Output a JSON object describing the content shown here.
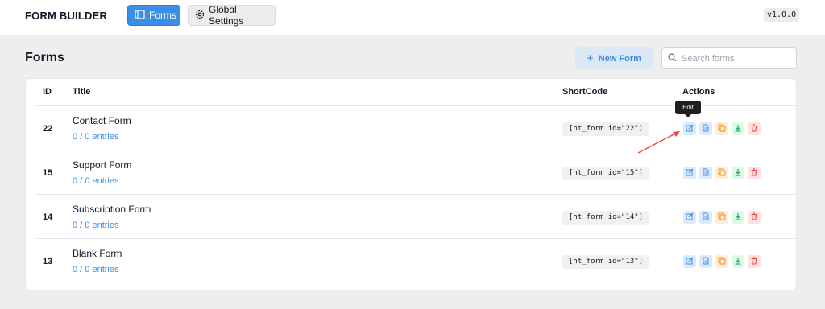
{
  "app": {
    "brand": "FORM BUILDER",
    "version": "v1.0.0",
    "nav": [
      {
        "label": "Forms",
        "active": true
      },
      {
        "label": "Global Settings",
        "active": false
      }
    ]
  },
  "page": {
    "title": "Forms",
    "new_form_label": "New Form",
    "search_placeholder": "Search forms"
  },
  "table": {
    "headers": {
      "id": "ID",
      "title": "Title",
      "shortcode": "ShortCode",
      "actions": "Actions"
    },
    "rows": [
      {
        "id": "22",
        "title": "Contact Form",
        "entries": "0 / 0 entries",
        "shortcode": "[ht_form id=\"22\"]"
      },
      {
        "id": "15",
        "title": "Support Form",
        "entries": "0 / 0 entries",
        "shortcode": "[ht_form id=\"15\"]"
      },
      {
        "id": "14",
        "title": "Subscription Form",
        "entries": "0 / 0 entries",
        "shortcode": "[ht_form id=\"14\"]"
      },
      {
        "id": "13",
        "title": "Blank Form",
        "entries": "0 / 0 entries",
        "shortcode": "[ht_form id=\"13\"]"
      }
    ],
    "action_icons": [
      "edit-icon",
      "view-icon",
      "duplicate-icon",
      "export-icon",
      "delete-icon"
    ]
  },
  "tooltip": {
    "label": "Edit"
  },
  "colors": {
    "accent": "#3b8ee4",
    "edit": "#3b8ee4",
    "view": "#3b8ee4",
    "duplicate": "#f08a24",
    "export": "#22a95a",
    "delete": "#ef4444",
    "annotation_arrow": "#ef4444"
  }
}
